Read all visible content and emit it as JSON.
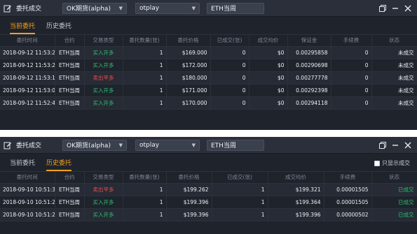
{
  "colors": {
    "accent": "#f3a01a",
    "buy": "#2fbf71",
    "sell": "#ee4b4b",
    "panel_bg": "#1f232c",
    "titlebar_bg": "#2a2f3a"
  },
  "panel1": {
    "icon": "edit-icon",
    "title": "委托成交",
    "exchange_select": "OK期货(alpha)",
    "account_select": "otplay",
    "contract_input": "ETH当周",
    "controls": [
      "restore-icon",
      "minimize-icon",
      "close-icon"
    ],
    "tabs": [
      {
        "label": "当前委托",
        "active": true
      },
      {
        "label": "历史委托",
        "active": false
      }
    ],
    "columns": [
      "委托时间",
      "合约",
      "交易类型",
      "委托数量(张)",
      "委托价格",
      "已成交(张)",
      "成交均价",
      "保证金",
      "手续费",
      "状态"
    ],
    "rows": [
      {
        "time": "2018-09-12 11:53:27",
        "contract": "ETH当周",
        "type": "买入开多",
        "side": "buy",
        "qty": "1",
        "price": "$169.000",
        "filled": "0",
        "avg": "$0",
        "margin": "0.00295858",
        "fee": "0",
        "status": "未成交"
      },
      {
        "time": "2018-09-12 11:53:20",
        "contract": "ETH当周",
        "type": "买入开多",
        "side": "buy",
        "qty": "1",
        "price": "$172.000",
        "filled": "0",
        "avg": "$0",
        "margin": "0.00290698",
        "fee": "0",
        "status": "未成交"
      },
      {
        "time": "2018-09-12 11:53:11",
        "contract": "ETH当周",
        "type": "卖出平多",
        "side": "sell",
        "qty": "1",
        "price": "$180.000",
        "filled": "0",
        "avg": "$0",
        "margin": "0.00277778",
        "fee": "0",
        "status": "未成交"
      },
      {
        "time": "2018-09-12 11:53:03",
        "contract": "ETH当周",
        "type": "买入开多",
        "side": "buy",
        "qty": "1",
        "price": "$171.000",
        "filled": "0",
        "avg": "$0",
        "margin": "0.00292398",
        "fee": "0",
        "status": "未成交"
      },
      {
        "time": "2018-09-12 11:52:43",
        "contract": "ETH当周",
        "type": "买入开多",
        "side": "buy",
        "qty": "1",
        "price": "$170.000",
        "filled": "0",
        "avg": "$0",
        "margin": "0.00294118",
        "fee": "0",
        "status": "未成交"
      }
    ]
  },
  "panel2": {
    "icon": "edit-icon",
    "title": "委托成交",
    "exchange_select": "OK期货(alpha)",
    "account_select": "otplay",
    "contract_input": "ETH当周",
    "controls": [
      "restore-icon",
      "minimize-icon",
      "close-icon"
    ],
    "tabs": [
      {
        "label": "当前委托",
        "active": false
      },
      {
        "label": "历史委托",
        "active": true
      }
    ],
    "show_done_label": "只显示成交",
    "columns": [
      "委托时间",
      "合约",
      "交易类型",
      "委托数量(张)",
      "委托价格",
      "已成交(张)",
      "成交均价",
      "手续费",
      "状态"
    ],
    "rows": [
      {
        "time": "2018-09-10 10:51:30",
        "contract": "ETH当周",
        "type": "卖出平多",
        "side": "sell",
        "qty": "1",
        "price": "$199.262",
        "filled": "1",
        "avg": "$199.321",
        "fee": "0.00001505",
        "status": "已成交"
      },
      {
        "time": "2018-09-10 10:51:23",
        "contract": "ETH当周",
        "type": "买入开多",
        "side": "buy",
        "qty": "1",
        "price": "$199.396",
        "filled": "1",
        "avg": "$199.364",
        "fee": "0.00001505",
        "status": "已成交"
      },
      {
        "time": "2018-09-10 10:51:23",
        "contract": "ETH当周",
        "type": "买入开多",
        "side": "buy",
        "qty": "1",
        "price": "$199.396",
        "filled": "1",
        "avg": "$199.396",
        "fee": "0.00000502",
        "status": "已成交"
      }
    ]
  }
}
